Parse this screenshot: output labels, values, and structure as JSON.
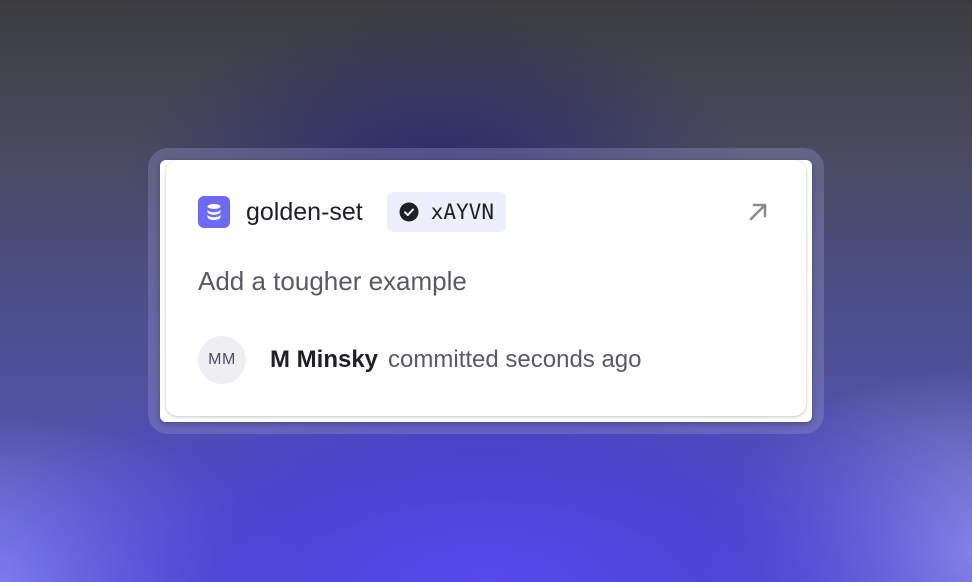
{
  "card": {
    "dataset_name": "golden-set",
    "commit_id": "xAYVN",
    "commit_message": "Add a tougher example",
    "author_initials": "MM",
    "author_name": "M Minsky",
    "timestamp": "committed seconds ago"
  },
  "icons": {
    "dataset": "database-icon",
    "verified": "check-circle-icon",
    "open": "arrow-up-right-icon"
  },
  "colors": {
    "accent": "#6d6af5",
    "badge_bg": "#edeffc"
  }
}
